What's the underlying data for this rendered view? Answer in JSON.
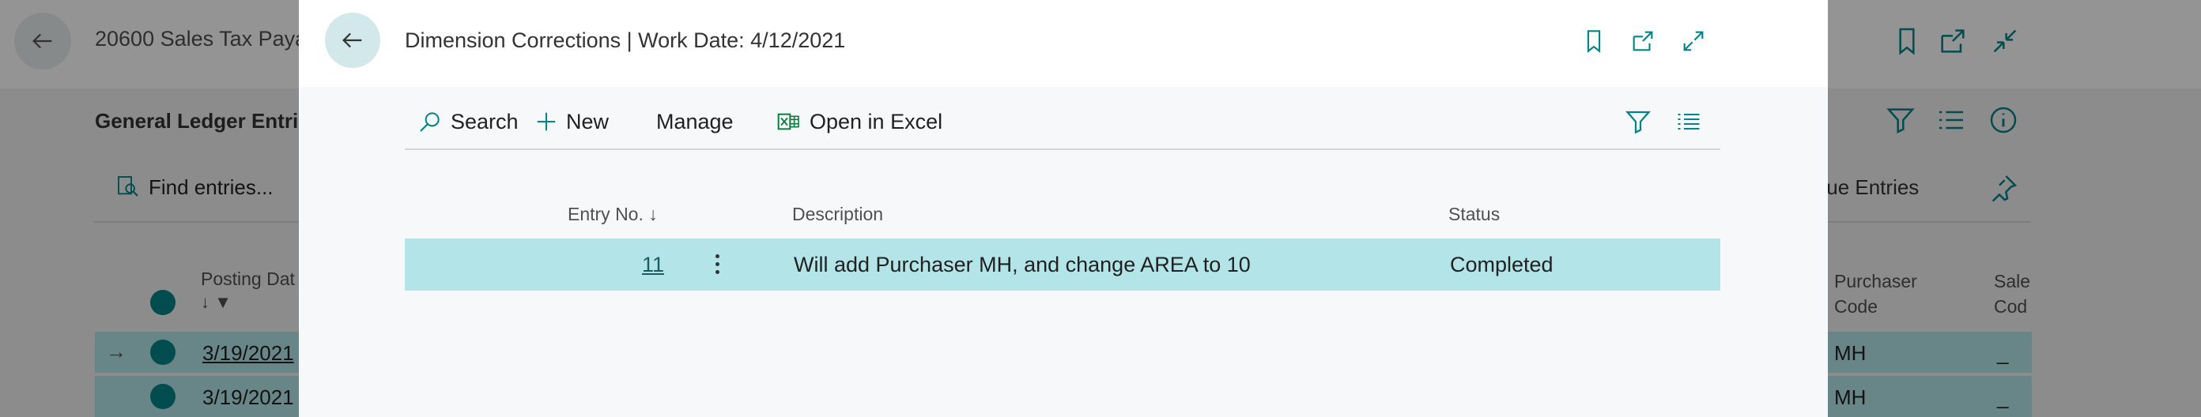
{
  "background": {
    "title": "20600 Sales Tax Paya",
    "subtitle": "General Ledger Entri",
    "find_entries": "Find entries...",
    "value_entries": "alue Entries",
    "posting_header": "Posting Dat",
    "purchaser_header_1": "Purchaser",
    "purchaser_header_2": "Code",
    "sales_header_1": "Sale",
    "sales_header_2": "Cod",
    "rows": [
      {
        "date": "3/19/2021",
        "purchaser": "MH",
        "sales": "_"
      },
      {
        "date": "3/19/2021",
        "purchaser": "MH",
        "sales": "_"
      }
    ]
  },
  "dialog": {
    "title": "Dimension Corrections | Work Date: 4/12/2021",
    "toolbar": {
      "search": "Search",
      "new": "New",
      "manage": "Manage",
      "open_excel": "Open in Excel"
    },
    "columns": {
      "entry_no": "Entry No.",
      "description": "Description",
      "status": "Status"
    },
    "rows": [
      {
        "entry_no": "11",
        "description": "Will add Purchaser MH, and change AREA to 10",
        "status": "Completed"
      }
    ]
  },
  "icons": {
    "back": "arrow-left-icon",
    "bookmark": "bookmark-icon",
    "open_new": "open-in-new-window-icon",
    "expand": "expand-icon",
    "collapse": "collapse-icon",
    "search": "search-icon",
    "new": "plus-icon",
    "excel": "excel-icon",
    "filter": "filter-icon",
    "list": "list-view-icon",
    "info": "info-icon",
    "sort": "sort-descending-icon"
  },
  "colors": {
    "accent": "#008489",
    "selected_row": "#b3e5e8",
    "back_button": "#d3e8ea"
  }
}
